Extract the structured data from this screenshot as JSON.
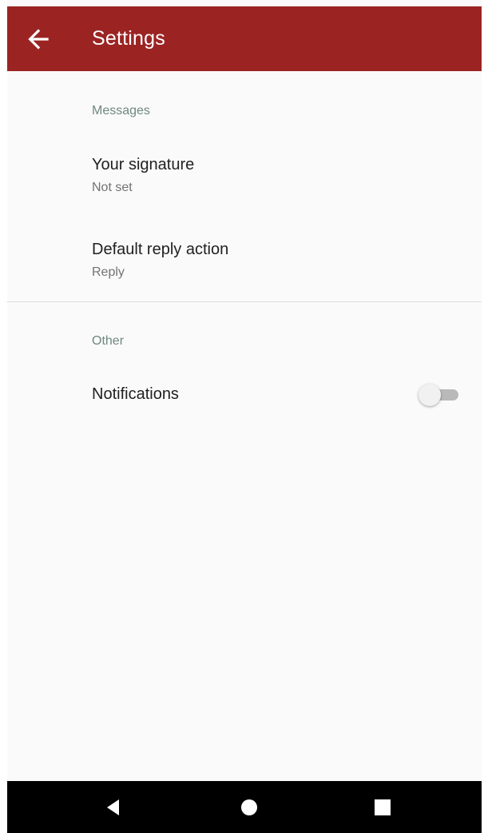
{
  "appbar": {
    "title": "Settings",
    "background_color": "#9b2423",
    "back_icon": "arrow-left-icon"
  },
  "sections": [
    {
      "header": "Messages",
      "items": [
        {
          "title": "Your signature",
          "summary": "Not set"
        },
        {
          "title": "Default reply action",
          "summary": "Reply"
        }
      ]
    },
    {
      "header": "Other",
      "items": [
        {
          "title": "Notifications",
          "toggle": false
        }
      ]
    }
  ],
  "navbar": {
    "icons": [
      "nav-back-icon",
      "nav-home-icon",
      "nav-recents-icon"
    ]
  }
}
